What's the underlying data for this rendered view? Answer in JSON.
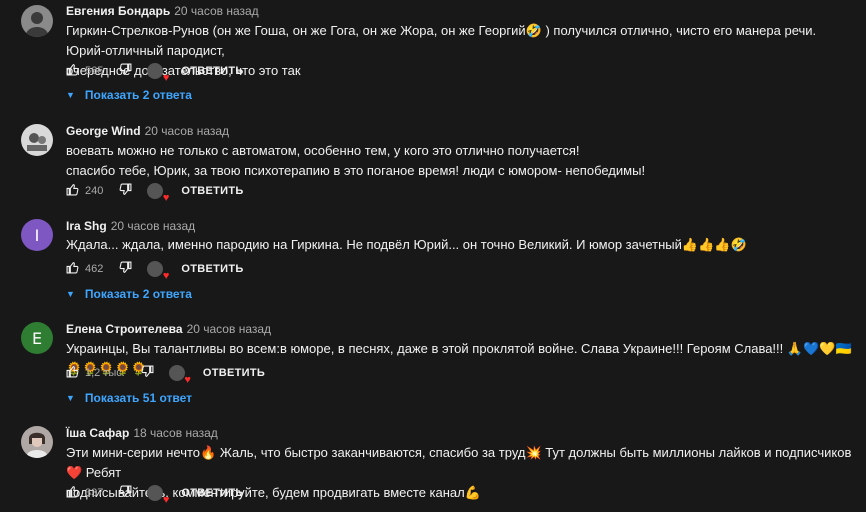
{
  "colors": {
    "bg": "#181818",
    "text": "#f1f1f1",
    "muted": "#aaaaaa",
    "link": "#3ea6ff",
    "heart": "#ff2a2a"
  },
  "reply_label": "ОТВЕТИТЬ",
  "comments": [
    {
      "author": "Евгения Бондарь",
      "time": "20 часов назад",
      "text": "Гиркин-Стрелков-Рунов (он же Гоша, он же Гога, он же Жора, он же Георгий🤣 ) получился отлично, чисто его манера речи. Юрий-отличный пародист,\nочередное доказательство, что это так",
      "likes": "565",
      "replies": "Показать 2 ответа"
    },
    {
      "author": "George Wind",
      "time": "20 часов назад",
      "text": "воевать можно не только с автоматом, особенно тем, у кого это отлично получается!\nспасибо тебе, Юрик, за твою психотерапию в это поганое время! люди с юмором- непобедимы!",
      "likes": "240"
    },
    {
      "author": "Ira Shg",
      "time": "20 часов назад",
      "avatar_letter": "I",
      "avatar_color": "#7e57c2",
      "text": "Ждала... ждала, именно пародию на Гиркина. Не подвёл Юрий... он точно Великий. И юмор зачетный👍👍👍🤣",
      "likes": "462",
      "replies": "Показать 2 ответа"
    },
    {
      "author": "Елена Строителева",
      "time": "20 часов назад",
      "avatar_letter": "E",
      "avatar_color": "#2e7d32",
      "text": "Украинцы, Вы талантливы во всем:в юморе, в песнях, даже в этой проклятой войне. Слава Украине!!! Героям Слава!!! 🙏💙💛🇺🇦🌻🌻🌻🌻🌻",
      "likes": "1,2 тыс.",
      "replies": "Показать 51 ответ"
    },
    {
      "author": "Їша Сафар",
      "time": "18 часов назад",
      "text": "Эти мини-серии нечто🔥 Жаль, что быстро заканчиваются, спасибо за труд💥 Тут должны быть миллионы лайков и подписчиков❤️ Ребят\nподписывайтесь, комментируйте, будем продвигать вместе канал💪",
      "likes": "337"
    }
  ]
}
